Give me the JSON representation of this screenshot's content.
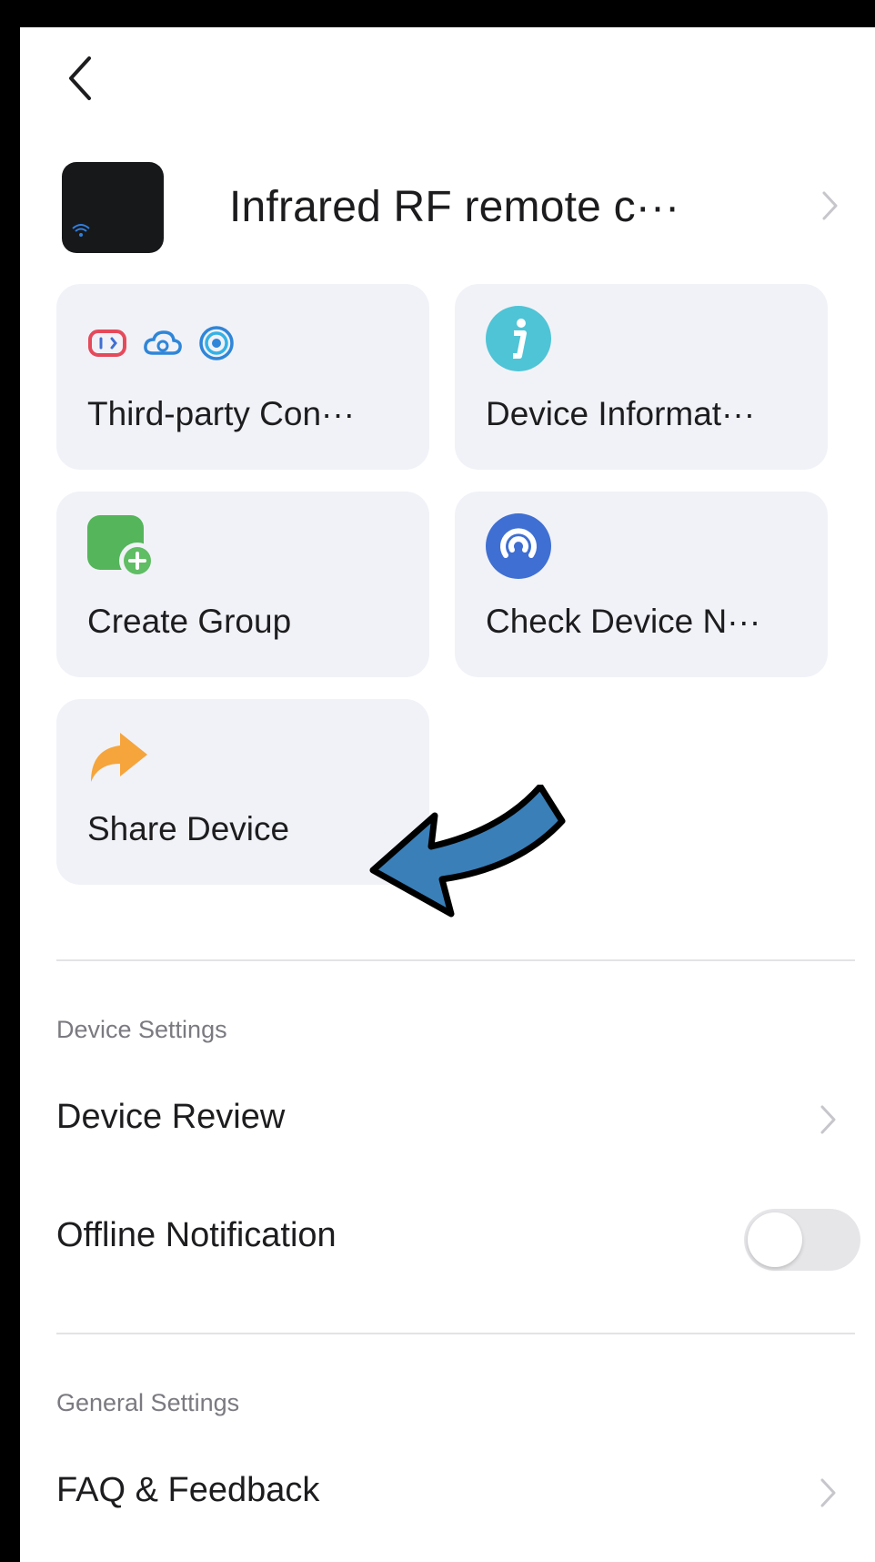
{
  "device": {
    "name": "Infrared RF remote c···"
  },
  "tiles": [
    {
      "label": "Third-party Con···",
      "icons": [
        "alexa-icon",
        "cloud-link-icon",
        "google-assistant-icon"
      ]
    },
    {
      "label": "Device Informat···",
      "icons": [
        "info-icon"
      ]
    },
    {
      "label": "Create Group",
      "icons": [
        "create-group-icon"
      ]
    },
    {
      "label": "Check Device N···",
      "icons": [
        "network-check-icon"
      ]
    },
    {
      "label": "Share Device",
      "icons": [
        "share-arrow-icon"
      ]
    }
  ],
  "device_settings": {
    "title": "Device Settings",
    "device_review": "Device Review",
    "offline_notification": "Offline Notification",
    "offline_notification_enabled": false
  },
  "general_settings": {
    "title": "General Settings",
    "faq": "FAQ & Feedback"
  },
  "colors": {
    "tile_bg": "#f1f2f7",
    "info": "#4fc4d6",
    "group": "#55b55b",
    "network": "#3f6fd2",
    "share": "#f5a53c",
    "annotation_arrow": "#3a7fb8"
  }
}
